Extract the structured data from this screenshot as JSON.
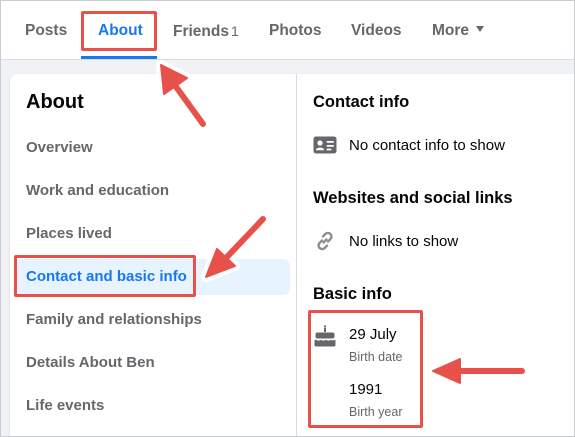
{
  "tabs": [
    {
      "label": "Posts"
    },
    {
      "label": "About"
    },
    {
      "label": "Friends",
      "count": "1"
    },
    {
      "label": "Photos"
    },
    {
      "label": "Videos"
    },
    {
      "label": "More"
    }
  ],
  "sidebar": {
    "title": "About",
    "items": [
      {
        "label": "Overview"
      },
      {
        "label": "Work and education"
      },
      {
        "label": "Places lived"
      },
      {
        "label": "Contact and basic info"
      },
      {
        "label": "Family and relationships"
      },
      {
        "label": "Details About Ben"
      },
      {
        "label": "Life events"
      }
    ]
  },
  "contact": {
    "title": "Contact info",
    "empty_text": "No contact info to show"
  },
  "websites": {
    "title": "Websites and social links",
    "empty_text": "No links to show"
  },
  "basic": {
    "title": "Basic info",
    "birth_date": "29 July",
    "birth_date_label": "Birth date",
    "birth_year": "1991",
    "birth_year_label": "Birth year"
  },
  "colors": {
    "accent": "#1877f2",
    "annotation": "#e8514a",
    "muted_text": "#65676b",
    "active_bg": "#e7f3ff"
  },
  "icons": [
    "id-card-icon",
    "link-icon",
    "birthday-cake-icon",
    "caret-down-icon"
  ]
}
